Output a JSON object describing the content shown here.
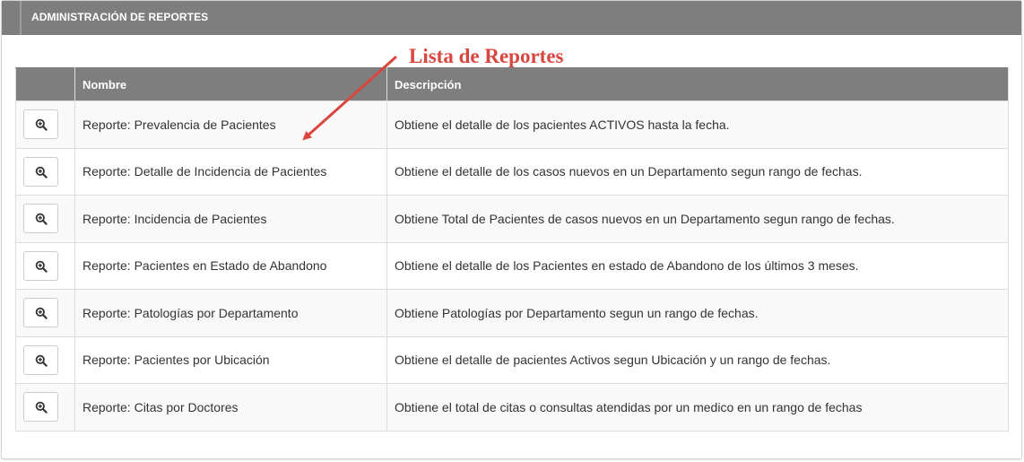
{
  "panel": {
    "title": "ADMINISTRACIÓN DE REPORTES"
  },
  "annotation": {
    "text": "Lista de Reportes",
    "color": "#d9463f"
  },
  "table": {
    "columns": [
      "",
      "Nombre",
      "Descripción"
    ],
    "rows": [
      {
        "action_icon": "zoom-in-icon",
        "name": "Reporte: Prevalencia de Pacientes",
        "description": "Obtiene el detalle de los pacientes ACTIVOS hasta la fecha."
      },
      {
        "action_icon": "zoom-in-icon",
        "name": "Reporte: Detalle de Incidencia de Pacientes",
        "description": "Obtiene el detalle de los casos nuevos en un Departamento segun rango de fechas."
      },
      {
        "action_icon": "zoom-in-icon",
        "name": "Reporte: Incidencia de Pacientes",
        "description": "Obtiene Total de Pacientes de casos nuevos en un Departamento segun rango de fechas."
      },
      {
        "action_icon": "zoom-in-icon",
        "name": "Reporte: Pacientes en Estado de Abandono",
        "description": "Obtiene el detalle de los Pacientes en estado de Abandono de los últimos 3 meses."
      },
      {
        "action_icon": "zoom-in-icon",
        "name": "Reporte: Patologías por Departamento",
        "description": "Obtiene Patologías por Departamento segun un rango de fechas."
      },
      {
        "action_icon": "zoom-in-icon",
        "name": "Reporte: Pacientes por Ubicación",
        "description": "Obtiene el detalle de pacientes Activos segun Ubicación y un rango de fechas."
      },
      {
        "action_icon": "zoom-in-icon",
        "name": "Reporte: Citas por Doctores",
        "description": "Obtiene el total de citas o consultas atendidas por un medico en un rango de fechas"
      }
    ]
  },
  "colors": {
    "header_bg": "#7e7e7e",
    "header_text": "#ffffff",
    "row_stripe": "#f9f9f9",
    "border": "#dddddd"
  }
}
